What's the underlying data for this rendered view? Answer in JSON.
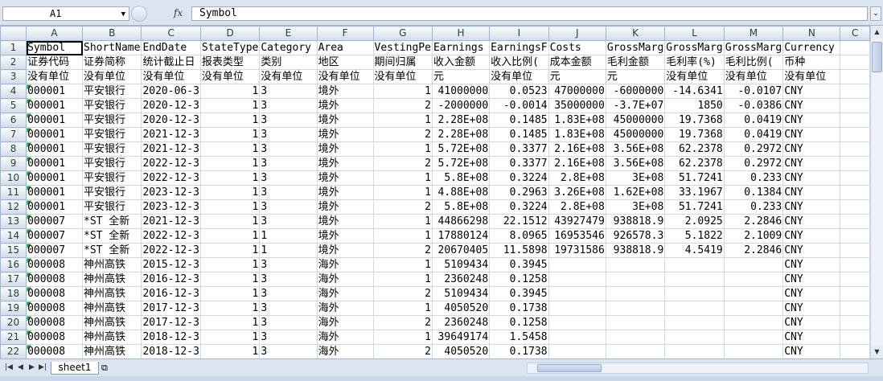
{
  "formula_bar": {
    "name_box": "A1",
    "fx_label": "fx",
    "formula": "Symbol"
  },
  "columns": [
    "A",
    "B",
    "C",
    "D",
    "E",
    "F",
    "G",
    "H",
    "I",
    "J",
    "K",
    "L",
    "M",
    "N",
    "C"
  ],
  "rows": [
    [
      "Symbol",
      "ShortName",
      "EndDate",
      "StateType",
      "Category",
      "Area",
      "VestingPe",
      "Earnings",
      "EarningsF",
      "Costs",
      "GrossMarg",
      "GrossMarg",
      "GrossMarg",
      "Currency",
      ""
    ],
    [
      "证券代码",
      "证券简称",
      "统计截止日",
      "报表类型",
      "类别",
      "地区",
      "期间归属",
      "收入金额",
      "收入比例(",
      "成本金额",
      "毛利金额",
      "毛利率(%)",
      "毛利比例(",
      "币种",
      ""
    ],
    [
      "没有单位",
      "没有单位",
      "没有单位",
      "没有单位",
      "没有单位",
      "没有单位",
      "没有单位",
      "元",
      "没有单位",
      "元",
      "元",
      "没有单位",
      "没有单位",
      "没有单位",
      ""
    ],
    [
      "000001",
      "平安银行",
      "2020-06-3",
      "1",
      "3",
      "境外",
      "1",
      "41000000",
      "0.0523",
      "47000000",
      "-6000000",
      "-14.6341",
      "-0.0107",
      "CNY",
      ""
    ],
    [
      "000001",
      "平安银行",
      "2020-12-3",
      "1",
      "3",
      "境外",
      "2",
      "-2000000",
      "-0.0014",
      "35000000",
      "-3.7E+07",
      "1850",
      "-0.0386",
      "CNY",
      ""
    ],
    [
      "000001",
      "平安银行",
      "2020-12-3",
      "1",
      "3",
      "境外",
      "1",
      "2.28E+08",
      "0.1485",
      "1.83E+08",
      "45000000",
      "19.7368",
      "0.0419",
      "CNY",
      ""
    ],
    [
      "000001",
      "平安银行",
      "2021-12-3",
      "1",
      "3",
      "境外",
      "2",
      "2.28E+08",
      "0.1485",
      "1.83E+08",
      "45000000",
      "19.7368",
      "0.0419",
      "CNY",
      ""
    ],
    [
      "000001",
      "平安银行",
      "2021-12-3",
      "1",
      "3",
      "境外",
      "1",
      "5.72E+08",
      "0.3377",
      "2.16E+08",
      "3.56E+08",
      "62.2378",
      "0.2972",
      "CNY",
      ""
    ],
    [
      "000001",
      "平安银行",
      "2022-12-3",
      "1",
      "3",
      "境外",
      "2",
      "5.72E+08",
      "0.3377",
      "2.16E+08",
      "3.56E+08",
      "62.2378",
      "0.2972",
      "CNY",
      ""
    ],
    [
      "000001",
      "平安银行",
      "2022-12-3",
      "1",
      "3",
      "境外",
      "1",
      "5.8E+08",
      "0.3224",
      "2.8E+08",
      "3E+08",
      "51.7241",
      "0.233",
      "CNY",
      ""
    ],
    [
      "000001",
      "平安银行",
      "2023-12-3",
      "1",
      "3",
      "境外",
      "1",
      "4.88E+08",
      "0.2963",
      "3.26E+08",
      "1.62E+08",
      "33.1967",
      "0.1384",
      "CNY",
      ""
    ],
    [
      "000001",
      "平安银行",
      "2023-12-3",
      "1",
      "3",
      "境外",
      "2",
      "5.8E+08",
      "0.3224",
      "2.8E+08",
      "3E+08",
      "51.7241",
      "0.233",
      "CNY",
      ""
    ],
    [
      "000007",
      "*ST 全新",
      "2021-12-3",
      "1",
      "3",
      "境外",
      "1",
      "44866298",
      "22.1512",
      "43927479",
      "938818.9",
      "2.0925",
      "2.2846",
      "CNY",
      ""
    ],
    [
      "000007",
      "*ST 全新",
      "2022-12-3",
      "1",
      "1",
      "境外",
      "1",
      "17880124",
      "8.0965",
      "16953546",
      "926578.3",
      "5.1822",
      "2.1009",
      "CNY",
      ""
    ],
    [
      "000007",
      "*ST 全新",
      "2022-12-3",
      "1",
      "1",
      "境外",
      "2",
      "20670405",
      "11.5898",
      "19731586",
      "938818.9",
      "4.5419",
      "2.2846",
      "CNY",
      ""
    ],
    [
      "000008",
      "神州高铁",
      "2015-12-3",
      "1",
      "3",
      "海外",
      "1",
      "5109434",
      "0.3945",
      "",
      "",
      "",
      "",
      "CNY",
      ""
    ],
    [
      "000008",
      "神州高铁",
      "2016-12-3",
      "1",
      "3",
      "海外",
      "1",
      "2360248",
      "0.1258",
      "",
      "",
      "",
      "",
      "CNY",
      ""
    ],
    [
      "000008",
      "神州高铁",
      "2016-12-3",
      "1",
      "3",
      "海外",
      "2",
      "5109434",
      "0.3945",
      "",
      "",
      "",
      "",
      "CNY",
      ""
    ],
    [
      "000008",
      "神州高铁",
      "2017-12-3",
      "1",
      "3",
      "海外",
      "1",
      "4050520",
      "0.1738",
      "",
      "",
      "",
      "",
      "CNY",
      ""
    ],
    [
      "000008",
      "神州高铁",
      "2017-12-3",
      "1",
      "3",
      "海外",
      "2",
      "2360248",
      "0.1258",
      "",
      "",
      "",
      "",
      "CNY",
      ""
    ],
    [
      "000008",
      "神州高铁",
      "2018-12-3",
      "1",
      "3",
      "海外",
      "1",
      "39649174",
      "1.5458",
      "",
      "",
      "",
      "",
      "CNY",
      ""
    ],
    [
      "000008",
      "神州高铁",
      "2018-12-3",
      "1",
      "3",
      "海外",
      "2",
      "4050520",
      "0.1738",
      "",
      "",
      "",
      "",
      "CNY",
      ""
    ]
  ],
  "numeric_columns": [
    3,
    6,
    7,
    8,
    9,
    10,
    11,
    12
  ],
  "sheet_tab": "sheet1"
}
